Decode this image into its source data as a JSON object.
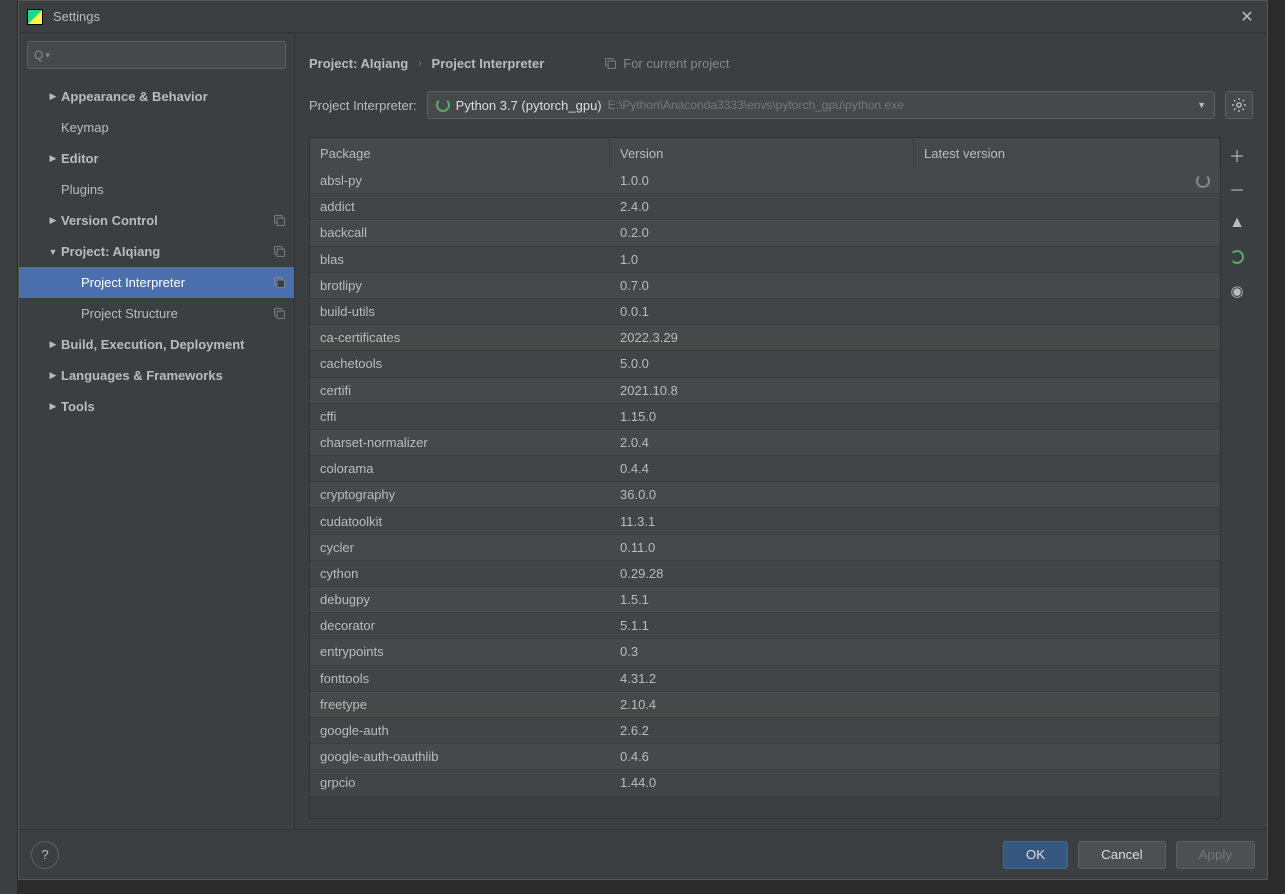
{
  "title": "Settings",
  "breadcrumb": {
    "project": "Project: AIqiang",
    "page": "Project Interpreter"
  },
  "for_current": "For current project",
  "interpreter": {
    "label": "Project Interpreter:",
    "name": "Python 3.7 (pytorch_gpu)",
    "path": "E:\\Python\\Anaconda3333\\envs\\pytorch_gpu\\python.exe"
  },
  "sidebar": {
    "items": [
      {
        "label": "Appearance & Behavior",
        "expandable": true,
        "expanded": false,
        "indent": 1
      },
      {
        "label": "Keymap",
        "expandable": false,
        "indent": 1,
        "leaf": true
      },
      {
        "label": "Editor",
        "expandable": true,
        "expanded": false,
        "indent": 1
      },
      {
        "label": "Plugins",
        "expandable": false,
        "indent": 1,
        "leaf": true
      },
      {
        "label": "Version Control",
        "expandable": true,
        "expanded": false,
        "indent": 1,
        "copy": true
      },
      {
        "label": "Project: AIqiang",
        "expandable": true,
        "expanded": true,
        "indent": 1,
        "copy": true
      },
      {
        "label": "Project Interpreter",
        "expandable": false,
        "indent": 2,
        "copy": true,
        "selected": true
      },
      {
        "label": "Project Structure",
        "expandable": false,
        "indent": 2,
        "copy": true
      },
      {
        "label": "Build, Execution, Deployment",
        "expandable": true,
        "expanded": false,
        "indent": 1
      },
      {
        "label": "Languages & Frameworks",
        "expandable": true,
        "expanded": false,
        "indent": 1
      },
      {
        "label": "Tools",
        "expandable": true,
        "expanded": false,
        "indent": 1
      }
    ]
  },
  "table": {
    "headers": {
      "pkg": "Package",
      "ver": "Version",
      "lat": "Latest version"
    },
    "rows": [
      {
        "pkg": "absl-py",
        "ver": "1.0.0",
        "spinner": true
      },
      {
        "pkg": "addict",
        "ver": "2.4.0"
      },
      {
        "pkg": "backcall",
        "ver": "0.2.0"
      },
      {
        "pkg": "blas",
        "ver": "1.0"
      },
      {
        "pkg": "brotlipy",
        "ver": "0.7.0"
      },
      {
        "pkg": "build-utils",
        "ver": "0.0.1"
      },
      {
        "pkg": "ca-certificates",
        "ver": "2022.3.29"
      },
      {
        "pkg": "cachetools",
        "ver": "5.0.0"
      },
      {
        "pkg": "certifi",
        "ver": "2021.10.8"
      },
      {
        "pkg": "cffi",
        "ver": "1.15.0"
      },
      {
        "pkg": "charset-normalizer",
        "ver": "2.0.4"
      },
      {
        "pkg": "colorama",
        "ver": "0.4.4"
      },
      {
        "pkg": "cryptography",
        "ver": "36.0.0"
      },
      {
        "pkg": "cudatoolkit",
        "ver": "11.3.1"
      },
      {
        "pkg": "cycler",
        "ver": "0.11.0"
      },
      {
        "pkg": "cython",
        "ver": "0.29.28"
      },
      {
        "pkg": "debugpy",
        "ver": "1.5.1"
      },
      {
        "pkg": "decorator",
        "ver": "5.1.1"
      },
      {
        "pkg": "entrypoints",
        "ver": "0.3"
      },
      {
        "pkg": "fonttools",
        "ver": "4.31.2"
      },
      {
        "pkg": "freetype",
        "ver": "2.10.4"
      },
      {
        "pkg": "google-auth",
        "ver": "2.6.2"
      },
      {
        "pkg": "google-auth-oauthlib",
        "ver": "0.4.6"
      },
      {
        "pkg": "grpcio",
        "ver": "1.44.0"
      }
    ]
  },
  "buttons": {
    "ok": "OK",
    "cancel": "Cancel",
    "apply": "Apply"
  }
}
